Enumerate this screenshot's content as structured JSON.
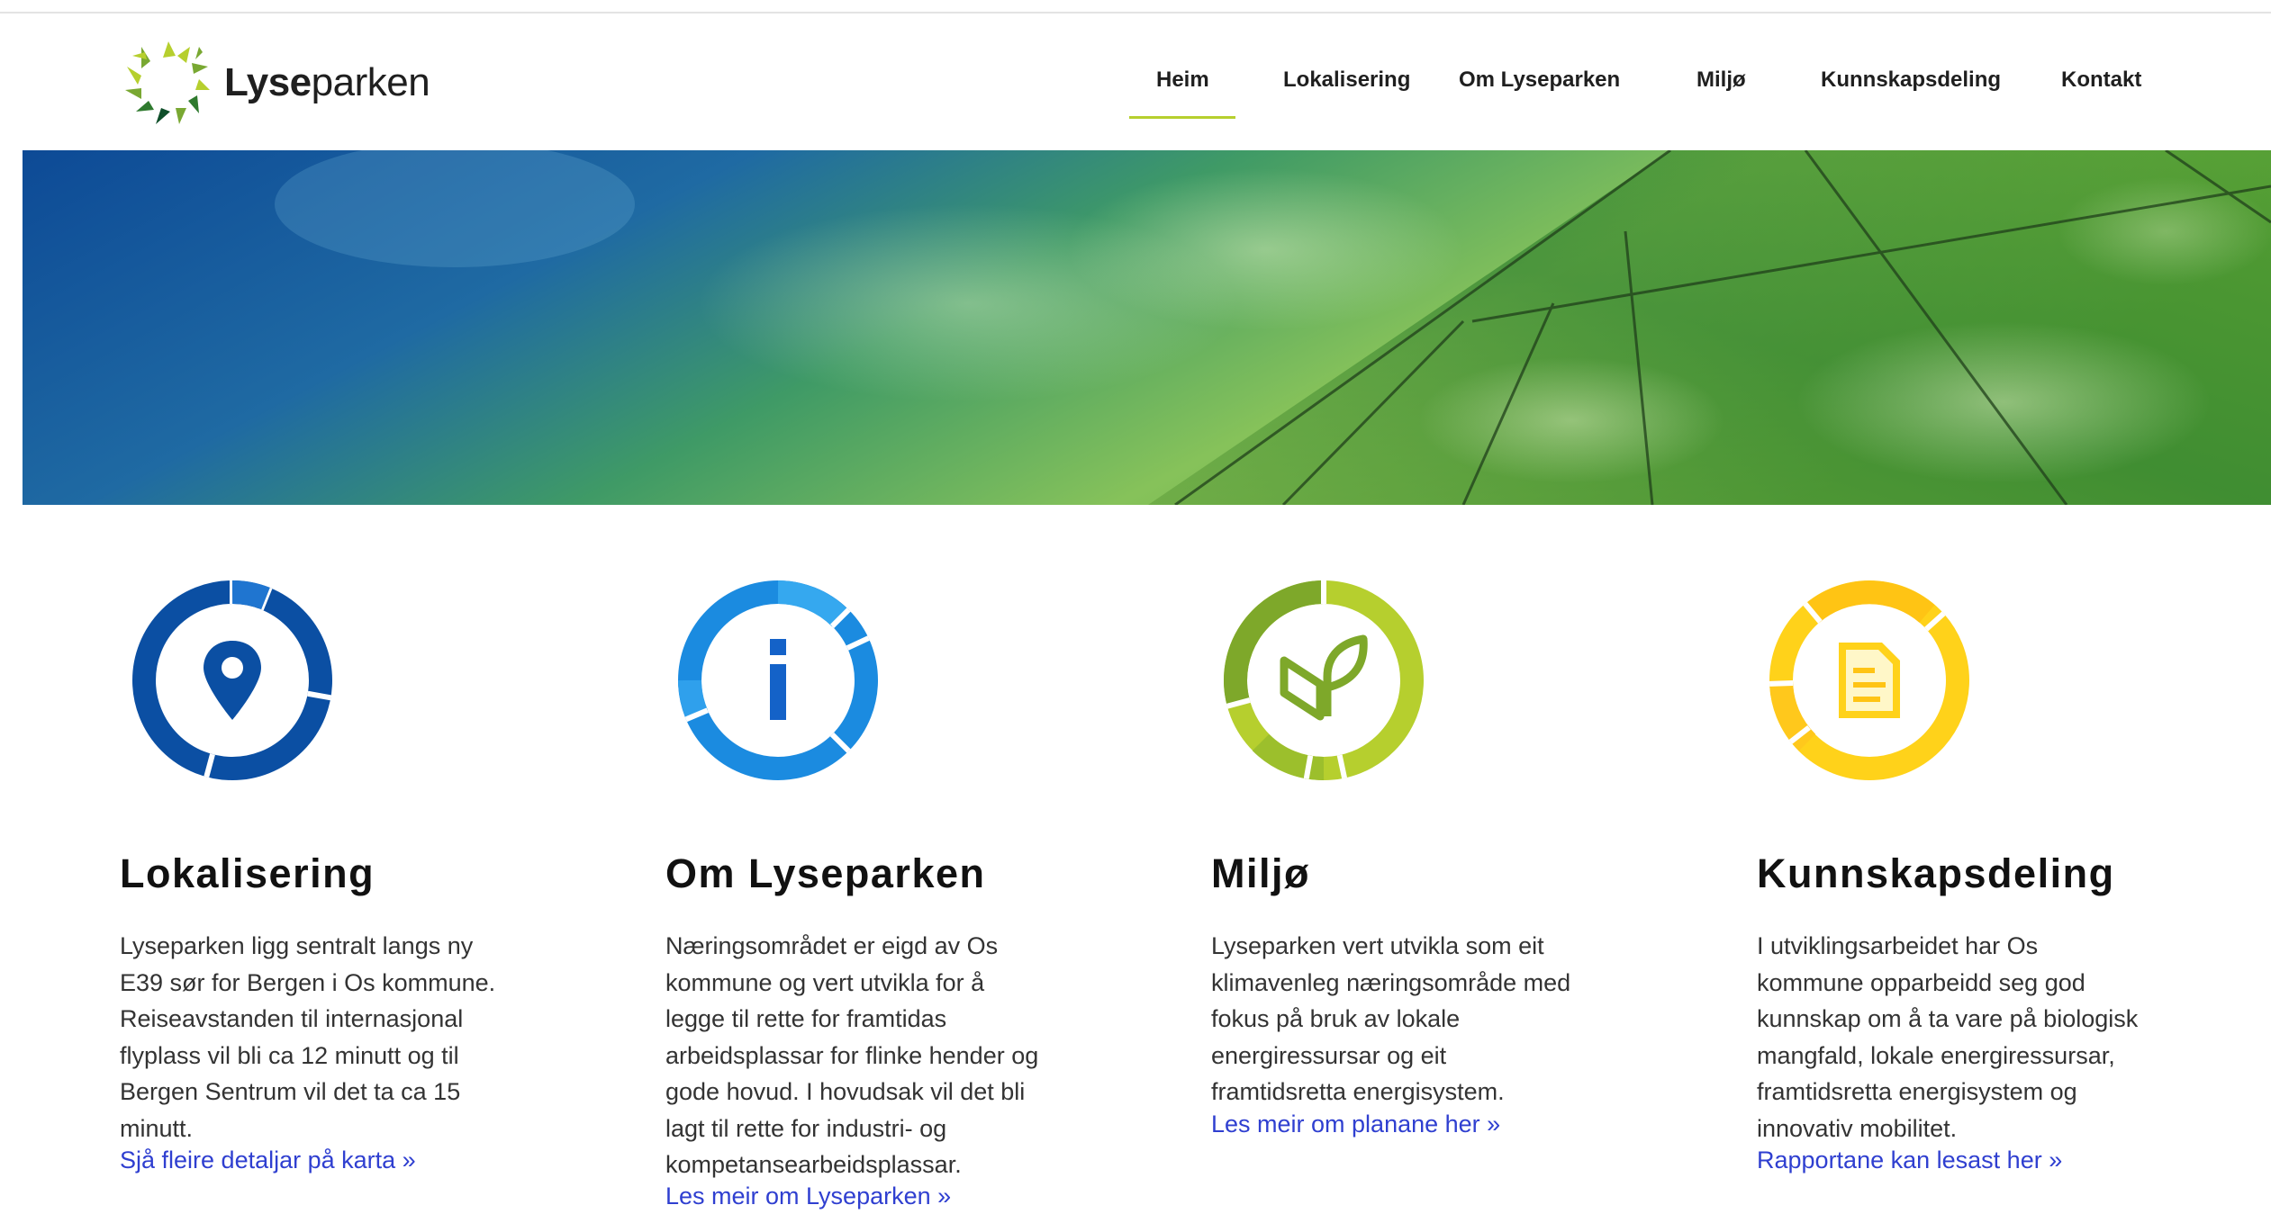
{
  "brand": {
    "name_bold": "Lyse",
    "name_regular": "parken",
    "logo_colors": [
      "#b6cf2e",
      "#79a832",
      "#2f7a2e",
      "#0f4f2a"
    ]
  },
  "nav": {
    "active": "Heim",
    "active_color": "#b6cf2e",
    "items": [
      {
        "label": "Heim"
      },
      {
        "label": "Lokalisering"
      },
      {
        "label": "Om Lyseparken"
      },
      {
        "label": "Miljø"
      },
      {
        "label": "Kunnskapsdeling"
      },
      {
        "label": "Kontakt"
      }
    ]
  },
  "hero": {
    "colors": [
      "#0d4a96",
      "#3f9a66",
      "#86c25a",
      "#2f7f2d"
    ]
  },
  "features": [
    {
      "icon": "location-pin-icon",
      "ring_color": "#0b4fa3",
      "title": "Lokalisering",
      "lines": [
        "Lyseparken ligg sentralt langs ny",
        "E39 sør for Bergen i Os kommune.",
        "Reiseavstanden til internasjonal",
        "flyplass vil bli ca 12 minutt og til",
        "Bergen Sentrum vil det ta ca 15",
        "minutt."
      ],
      "link": "Sjå fleire detaljar på karta »"
    },
    {
      "icon": "info-icon",
      "ring_color": "#1b8be0",
      "title": "Om Lyseparken",
      "lines": [
        "Næringsområdet er eigd av Os",
        "kommune og vert utvikla for å",
        "legge til rette for framtidas",
        "arbeidsplassar for flinke hender og",
        "gode hovud. I hovudsak vil det bli",
        "lagt til rette for industri- og",
        "kompetansearbeidsplassar."
      ],
      "link": "Les meir om Lyseparken »"
    },
    {
      "icon": "leaf-icon",
      "ring_color": "#8db32b",
      "title": "Miljø",
      "lines": [
        "Lyseparken vert utvikla som eit",
        "klimavenleg næringsområde med",
        "fokus på bruk av lokale",
        "energiressursar og eit",
        "framtidsretta energisystem."
      ],
      "link": "Les meir om planane her  »"
    },
    {
      "icon": "document-icon",
      "ring_color": "#ffd21a",
      "title": "Kunnskapsdeling",
      "lines": [
        "I utviklingsarbeidet har Os",
        "kommune opparbeidd  seg god",
        "kunnskap om å ta vare på biologisk",
        "mangfald, lokale energiressursar,",
        "framtidsretta energisystem og",
        "innovativ mobilitet."
      ],
      "link": "Rapportane kan lesast her »"
    }
  ]
}
